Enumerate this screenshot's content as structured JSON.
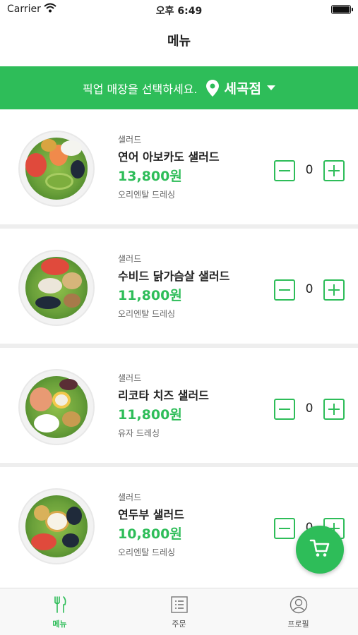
{
  "status_bar": {
    "carrier": "Carrier",
    "time": "오후 6:49"
  },
  "nav": {
    "title": "메뉴"
  },
  "store_banner": {
    "prompt": "픽업 매장을 선택하세요.",
    "store_name": "세곡점"
  },
  "menu_items": [
    {
      "category": "샐러드",
      "name": "연어 아보카도 샐러드",
      "price": "13,800원",
      "dressing": "오리엔탈 드레싱",
      "quantity": "0"
    },
    {
      "category": "샐러드",
      "name": "수비드 닭가슴살 샐러드",
      "price": "11,800원",
      "dressing": "오리엔탈 드레싱",
      "quantity": "0"
    },
    {
      "category": "샐러드",
      "name": "리코타 치즈 샐러드",
      "price": "11,800원",
      "dressing": "유자 드레싱",
      "quantity": "0"
    },
    {
      "category": "샐러드",
      "name": "연두부 샐러드",
      "price": "10,800원",
      "dressing": "오리엔탈 드레싱",
      "quantity": "0"
    }
  ],
  "tabs": [
    {
      "label": "메뉴",
      "icon": "fork-knife-icon",
      "active": true
    },
    {
      "label": "주문",
      "icon": "order-list-icon",
      "active": false
    },
    {
      "label": "프로필",
      "icon": "profile-icon",
      "active": false
    }
  ],
  "colors": {
    "accent": "#2ebd59",
    "divider": "#eeeeee",
    "tab_bar_bg": "#f8f8f8"
  }
}
